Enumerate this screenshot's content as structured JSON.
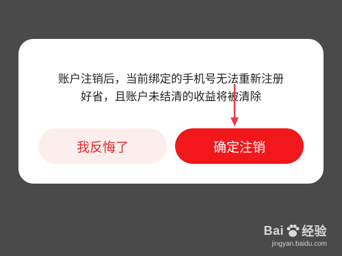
{
  "dialog": {
    "message_line1": "账户注销后，当前绑定的手机号无法重新注册",
    "message_line2": "好省，且账户未结清的收益将被清除",
    "regret_label": "我反悔了",
    "confirm_label": "确定注销"
  },
  "colors": {
    "backdrop": "#4a4a4a",
    "confirm_bg": "#f2171a",
    "regret_bg": "#fdeeee",
    "regret_text": "#e12a2a",
    "annotation_arrow": "#e83a4b"
  },
  "watermark": {
    "brand_prefix": "Bai",
    "brand_suffix": "经验",
    "url": "jingyan.baidu.com"
  }
}
